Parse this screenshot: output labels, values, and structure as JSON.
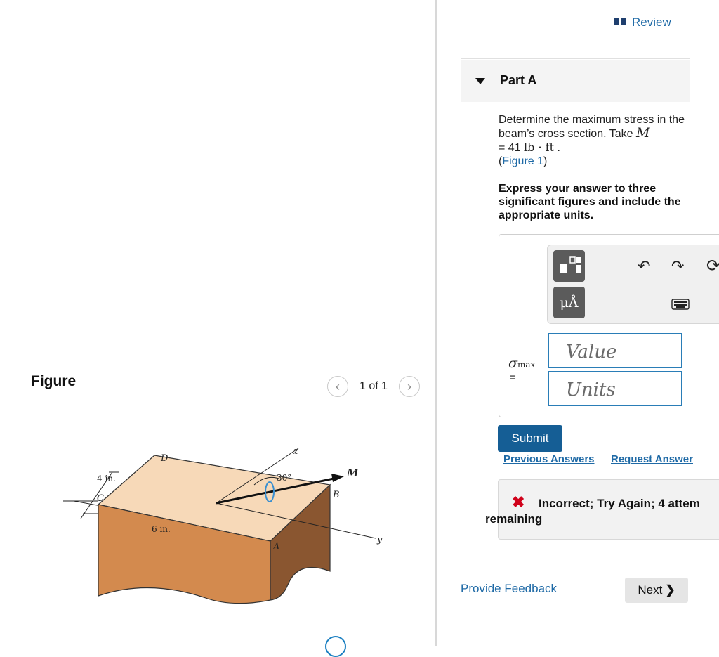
{
  "figure_panel": {
    "title": "Figure",
    "pager": {
      "current": "1 of 1",
      "prev_icon": "chevron-left-icon",
      "next_icon": "chevron-right-icon"
    },
    "diagram": {
      "dimension_width": "4 in.",
      "dimension_length": "6 in.",
      "angle": "30°",
      "moment_label": "M",
      "points": {
        "a": "A",
        "b": "B",
        "c": "C",
        "d": "D"
      },
      "axes": {
        "z": "z",
        "y": "y"
      }
    }
  },
  "review": {
    "label": "Review",
    "icon": "book-icon"
  },
  "part": {
    "title": "Part A",
    "caret_icon": "caret-down-icon"
  },
  "question": {
    "text": "Determine the maximum stress in the beam’s cross section. Take",
    "symbol": "M",
    "eq": "= 41",
    "unit": "lb · ft",
    "period": ".",
    "figure_link": "Figure 1",
    "open_paren": "(",
    "close_paren": ")"
  },
  "instruction": "Express your answer to three significant figures and include the appropriate units.",
  "answer": {
    "variable": "σ",
    "subscript": "max",
    "equals": "=",
    "value_placeholder": "Value",
    "units_placeholder": "Units",
    "units_button": "μÅ",
    "toolbar_icons": [
      "templates-icon",
      "units-icon",
      "undo-icon",
      "redo-icon",
      "reset-icon",
      "keyboard-icon"
    ]
  },
  "actions": {
    "submit": "Submit",
    "previous_answers": "Previous Answers",
    "request_answer": "Request Answer"
  },
  "feedback": {
    "icon": "x-icon",
    "message": "Incorrect; Try Again; 4 attem",
    "message_line2": "remaining"
  },
  "footer": {
    "provide_feedback": "Provide Feedback",
    "next": "Next",
    "next_icon": "chevron-right-icon"
  },
  "colors": {
    "link": "#1f6aa6",
    "submit": "#155e95",
    "error": "#d0021b",
    "block_top": "#f7d9b8",
    "block_front": "#d38a4e",
    "block_side": "#8a5630"
  }
}
